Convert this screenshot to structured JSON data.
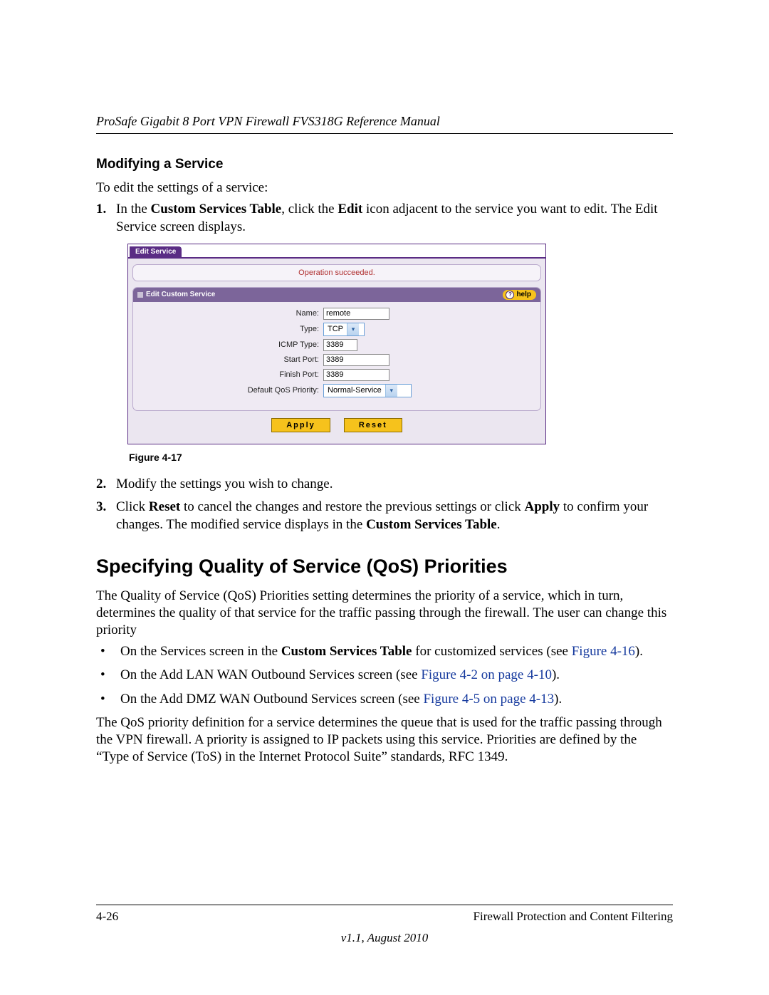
{
  "header": {
    "running_title": "ProSafe Gigabit 8 Port VPN Firewall FVS318G Reference Manual"
  },
  "section1": {
    "heading": "Modifying a Service",
    "intro": "To edit the settings of a service:",
    "step1_num": "1.",
    "step1_a": "In the ",
    "step1_b": "Custom Services Table",
    "step1_c": ", click the ",
    "step1_d": "Edit",
    "step1_e": " icon adjacent to the service you want to edit. The Edit Service screen displays."
  },
  "screenshot": {
    "tab": "Edit Service",
    "status": "Operation succeeded.",
    "panel_title": "Edit Custom Service",
    "help_label": "help",
    "fields": {
      "name_label": "Name:",
      "name_value": "remote",
      "type_label": "Type:",
      "type_value": "TCP",
      "icmp_label": "ICMP Type:",
      "icmp_value": "3389",
      "start_label": "Start Port:",
      "start_value": "3389",
      "finish_label": "Finish Port:",
      "finish_value": "3389",
      "qos_label": "Default QoS Priority:",
      "qos_value": "Normal-Service"
    },
    "buttons": {
      "apply": "Apply",
      "reset": "Reset"
    }
  },
  "fig_caption": "Figure 4-17",
  "section1b": {
    "step2_num": "2.",
    "step2": "Modify the settings you wish to change.",
    "step3_num": "3.",
    "step3_a": "Click ",
    "step3_b": "Reset",
    "step3_c": " to cancel the changes and restore the previous settings or click ",
    "step3_d": "Apply",
    "step3_e": " to confirm your changes. The modified service displays in the ",
    "step3_f": "Custom Services Table",
    "step3_g": "."
  },
  "section2": {
    "heading": "Specifying Quality of Service (QoS) Priorities",
    "para1": "The Quality of Service (QoS) Priorities setting determines the priority of a service, which in turn, determines the quality of that service for the traffic passing through the firewall. The user can change this priority",
    "b1_a": "On the Services screen in the ",
    "b1_b": "Custom Services Table",
    "b1_c": " for customized services (see ",
    "b1_link": "Figure 4-16",
    "b1_d": ").",
    "b2_a": "On the Add LAN WAN Outbound Services screen (see ",
    "b2_link": "Figure 4-2 on page 4-10",
    "b2_b": ").",
    "b3_a": "On the Add DMZ WAN Outbound Services screen (see ",
    "b3_link": "Figure 4-5 on page 4-13",
    "b3_b": ").",
    "para2": "The QoS priority definition for a service determines the queue that is used for the traffic passing through the VPN firewall. A priority is assigned to IP packets using this service. Priorities are defined by the “Type of Service (ToS) in the Internet Protocol Suite” standards, RFC 1349."
  },
  "footer": {
    "page": "4-26",
    "chapter": "Firewall Protection and Content Filtering",
    "version": "v1.1, August 2010"
  }
}
